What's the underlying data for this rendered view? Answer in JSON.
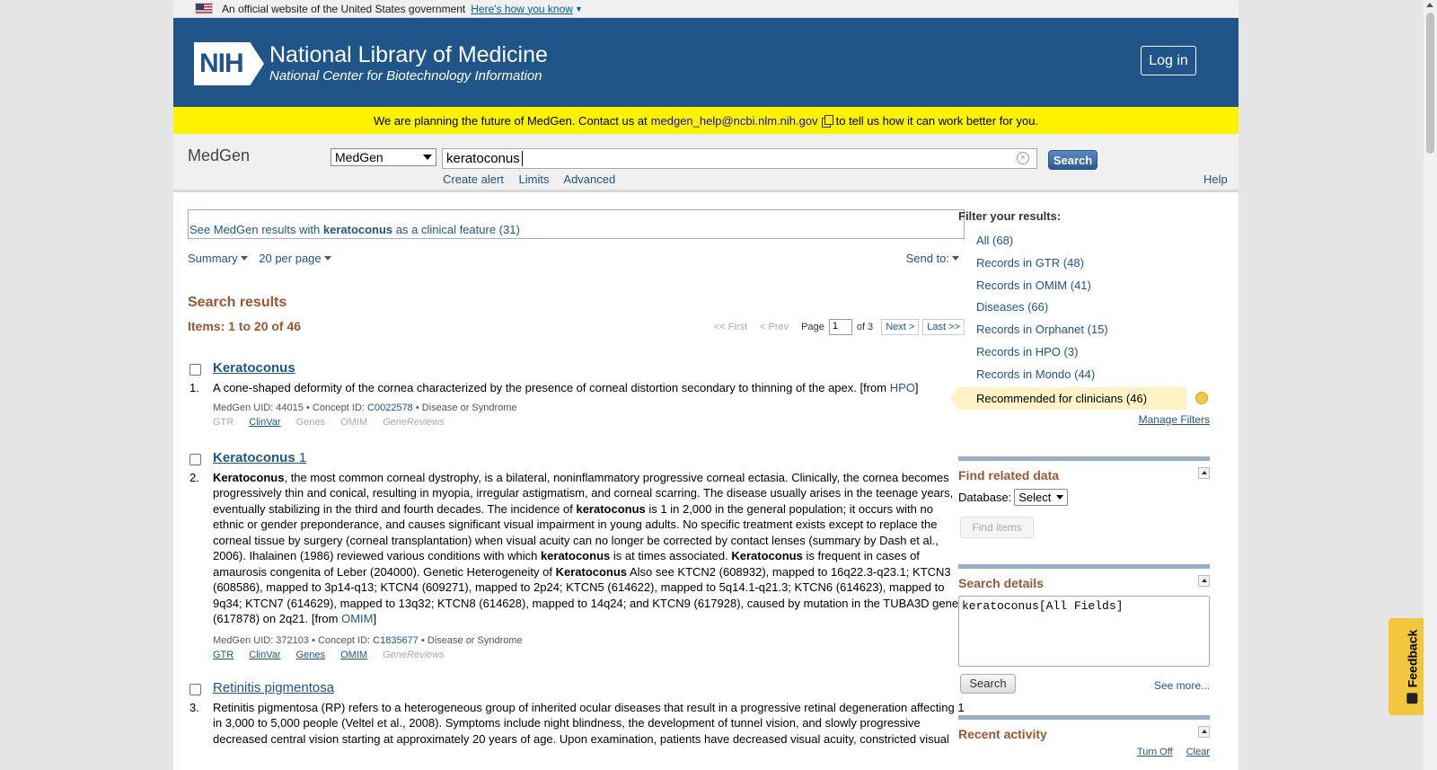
{
  "gov_banner": {
    "text": "An official website of the United States government",
    "link": "Here's how you know"
  },
  "header": {
    "logo_badge": "NIH",
    "title": "National Library of Medicine",
    "subtitle": "National Center for Biotechnology Information",
    "login": "Log in"
  },
  "notice": {
    "before": "We are planning the future of MedGen. Contact us at",
    "email": "medgen_help@ncbi.nlm.nih.gov",
    "after": "to tell us how it can work better for you."
  },
  "search": {
    "db_name": "MedGen",
    "db_select": "MedGen",
    "term": "keratoconus",
    "button": "Search",
    "links": [
      "Create alert",
      "Limits",
      "Advanced"
    ],
    "help": "Help"
  },
  "clinical_feature": {
    "prefix": "See MedGen results with ",
    "term": "keratoconus",
    "suffix": " as a clinical feature (31)"
  },
  "toolbar": {
    "summary": "Summary",
    "per_page": "20 per page",
    "send_to": "Send to:"
  },
  "results": {
    "title": "Search results",
    "items": "Items: 1 to 20 of 46",
    "pager": {
      "first": "<< First",
      "prev": "< Prev",
      "page_label": "Page",
      "page": "1",
      "of": "of 3",
      "next": "Next >",
      "last": "Last >>"
    },
    "list": [
      {
        "num": "1.",
        "title": "Keratoconus",
        "desc_main": "A cone-shaped deformity of the cornea characterized by the presence of corneal distortion secondary to thinning of the apex. [from ",
        "desc_src": "HPO",
        "desc_end": "]",
        "uid": "MedGen UID: 44015 •",
        "concept_label": "Concept ID:",
        "concept": "C0022578",
        "type": "• Disease or Syndrome",
        "links": [
          "GTR",
          "ClinVar",
          "Genes",
          "OMIM",
          "GeneReviews"
        ]
      },
      {
        "num": "2.",
        "title": "Keratoconus",
        "title_suffix": "1",
        "desc_p1": "Keratoconus",
        "desc_p2": ", the most common corneal dystrophy, is a bilateral, noninflammatory progressive corneal ectasia. Clinically, the cornea becomes progressively thin and conical, resulting in myopia, irregular astigmatism, and corneal scarring. The disease usually arises in the teenage years, eventually stabilizing in the third and fourth decades. The incidence of ",
        "desc_p3": "keratoconus",
        "desc_p4": " is 1 in 2,000 in the general population; it occurs with no ethnic or gender preponderance, and causes significant visual impairment in young adults. No specific treatment exists except to replace the corneal tissue by surgery (corneal transplantation) when visual acuity can no longer be corrected by contact lenses (summary by Dash et al., 2006). Ihalainen (1986) reviewed various conditions with which ",
        "desc_p5": "keratoconus",
        "desc_p6": " is at times associated. ",
        "desc_p7": "Keratoconus",
        "desc_p8": " is frequent in cases of amaurosis congenita of Leber (204000). Genetic Heterogeneity of ",
        "desc_p9": "Keratoconus",
        "desc_p10": " Also see KTCN2 (608932), mapped to 16q22.3-q23.1; KTCN3 (608586), mapped to 3p14-q13; KTCN4 (609271), mapped to 2p24; KTCN5 (614622), mapped to 5q14.1-q21.3; KTCN6 (614623), mapped to 9q34; KTCN7 (614629), mapped to 13q32; KTCN8 (614628), mapped to 14q24; and KTCN9 (617928), caused by mutation in the TUBA3D gene (617878) on 2q21. [from ",
        "desc_src": "OMIM",
        "desc_end": "]",
        "uid": "MedGen UID: 372103 •",
        "concept_label": "Concept ID:",
        "concept": "C1835677",
        "type": "• Disease or Syndrome",
        "links": [
          "GTR",
          "ClinVar",
          "Genes",
          "OMIM",
          "GeneReviews"
        ]
      },
      {
        "num": "3.",
        "title": "Retinitis pigmentosa",
        "desc": "Retinitis pigmentosa (RP) refers to a heterogeneous group of inherited ocular diseases that result in a progressive retinal degeneration affecting 1 in 3,000 to 5,000 people (Veltel et al., 2008). Symptoms include night blindness, the development of tunnel vision, and slowly progressive decreased central vision starting at approximately 20 years of age. Upon examination, patients have decreased visual acuity, constricted visual"
      }
    ]
  },
  "sidebar": {
    "filter_title": "Filter your results:",
    "filters": [
      "All (68)",
      "Records in GTR (48)",
      "Records in OMIM (41)",
      "Diseases (66)",
      "Records in Orphanet (15)",
      "Records in HPO (3)",
      "Records in Mondo (44)"
    ],
    "recommended": "Recommended for clinicians (46)",
    "manage": "Manage Filters",
    "related": {
      "title": "Find related data",
      "db_label": "Database:",
      "db_select": "Select",
      "button": "Find items"
    },
    "details": {
      "title": "Search details",
      "query": "keratoconus[All Fields]",
      "button": "Search",
      "see_more": "See more..."
    },
    "recent": {
      "title": "Recent activity",
      "turn_off": "Turn Off",
      "clear": "Clear"
    }
  },
  "feedback": "Feedback"
}
